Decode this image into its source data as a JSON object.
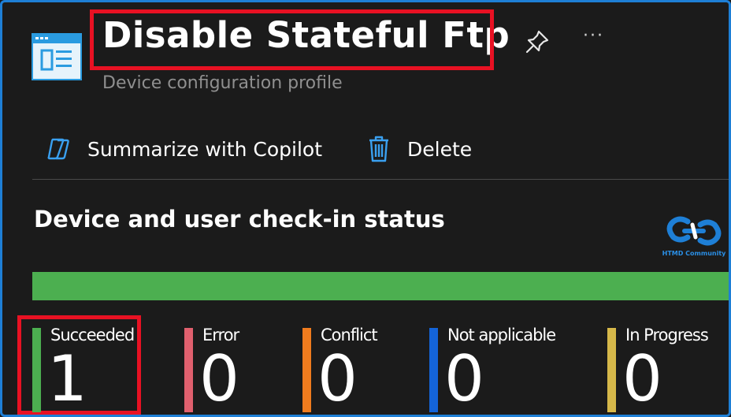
{
  "header": {
    "title": "Disable Stateful Ftp",
    "subtitle": "Device configuration profile",
    "more_label": "···",
    "profile_icon": "profile-document-icon",
    "pin_icon": "pin-icon"
  },
  "toolbar": {
    "copilot_label": "Summarize with Copilot",
    "copilot_icon": "copilot-icon",
    "delete_label": "Delete",
    "delete_icon": "trash-icon"
  },
  "section": {
    "title": "Device and user check-in status"
  },
  "logo": {
    "text": "HTMD Community"
  },
  "status_bar": {
    "succeeded_fraction": 1.0,
    "color": "#4caf50"
  },
  "tiles": [
    {
      "label": "Succeeded",
      "count": "1",
      "color": "#4caf50"
    },
    {
      "label": "Error",
      "count": "0",
      "color": "#e0606e"
    },
    {
      "label": "Conflict",
      "count": "0",
      "color": "#f07c1e"
    },
    {
      "label": "Not applicable",
      "count": "0",
      "color": "#1464d8"
    },
    {
      "label": "In Progress",
      "count": "0",
      "color": "#d6b84a"
    }
  ],
  "highlight_color": "#e81123",
  "accent_color": "#1e7fd6"
}
